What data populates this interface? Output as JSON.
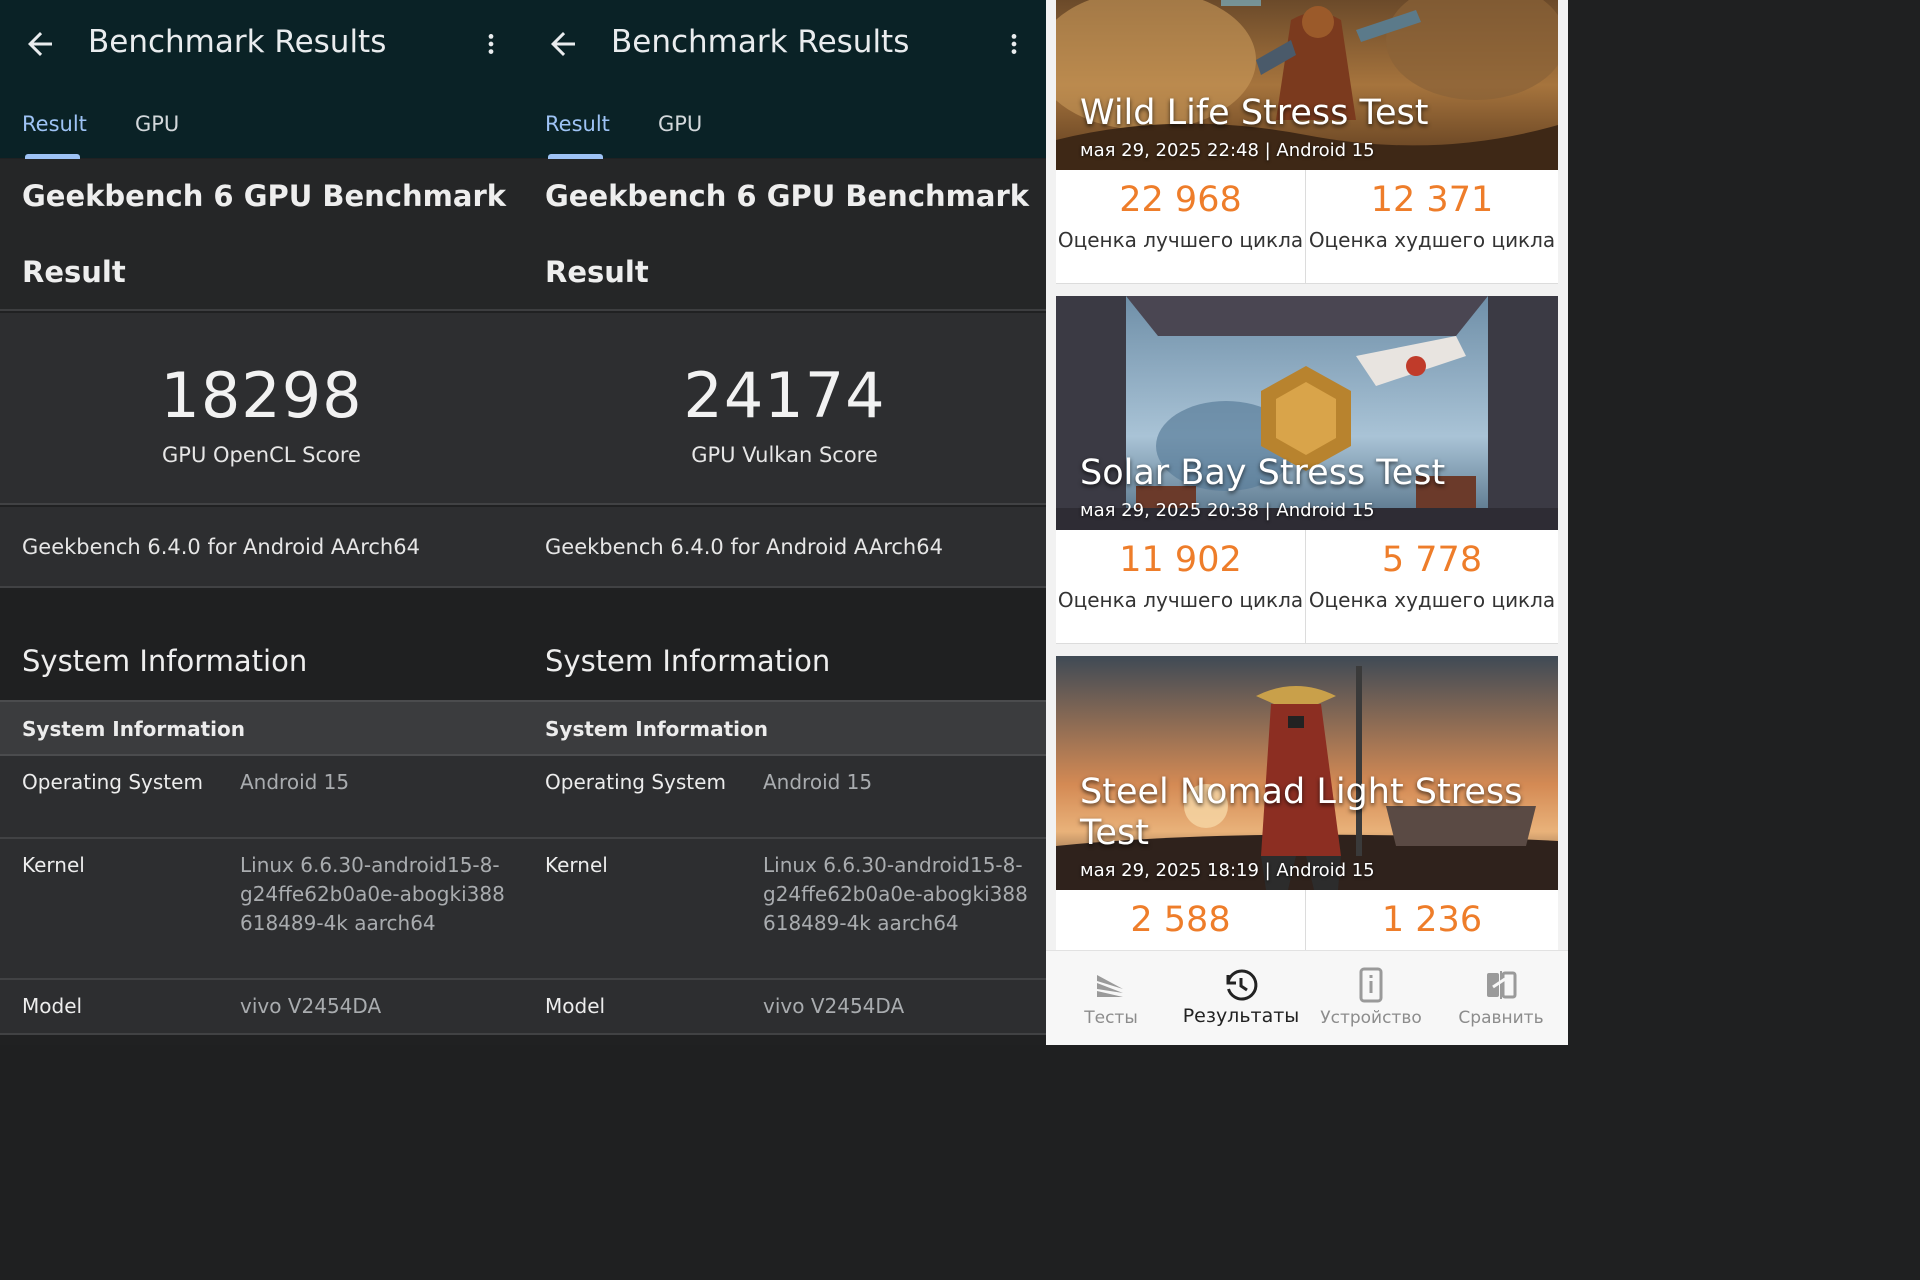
{
  "geekbench_panels": [
    {
      "title": "Benchmark Results",
      "tabs": [
        "Result",
        "GPU"
      ],
      "benchmark_title": "Geekbench 6 GPU Benchmark",
      "section_result": "Result",
      "score": "18298",
      "score_label": "GPU OpenCL Score",
      "version": "Geekbench 6.4.0 for Android AArch64",
      "system_info_title": "System Information",
      "system_info_bar": "System Information",
      "rows": [
        {
          "label": "Operating System",
          "value": "Android 15"
        },
        {
          "label": "Kernel",
          "value": "Linux 6.6.30-android15-8-g24ffe62b0a0e-abogki388618489-4k aarch64"
        },
        {
          "label": "Model",
          "value": "vivo V2454DA"
        }
      ]
    },
    {
      "title": "Benchmark Results",
      "tabs": [
        "Result",
        "GPU"
      ],
      "benchmark_title": "Geekbench 6 GPU Benchmark",
      "section_result": "Result",
      "score": "24174",
      "score_label": "GPU Vulkan Score",
      "version": "Geekbench 6.4.0 for Android AArch64",
      "system_info_title": "System Information",
      "system_info_bar": "System Information",
      "rows": [
        {
          "label": "Operating System",
          "value": "Android 15"
        },
        {
          "label": "Kernel",
          "value": "Linux 6.6.30-android15-8-g24ffe62b0a0e-abogki388618489-4k aarch64"
        },
        {
          "label": "Model",
          "value": "vivo V2454DA"
        }
      ]
    }
  ],
  "tdmark": {
    "results": [
      {
        "name": "Wild Life Stress Test",
        "meta": "мая 29, 2025 22:48 | Android 15",
        "best_score": "22 968",
        "best_label": "Оценка лучшего цикла",
        "worst_score": "12 371",
        "worst_label": "Оценка худшего цикла"
      },
      {
        "name": "Solar Bay Stress Test",
        "meta": "мая 29, 2025 20:38 | Android 15",
        "best_score": "11 902",
        "best_label": "Оценка лучшего цикла",
        "worst_score": "5 778",
        "worst_label": "Оценка худшего цикла"
      },
      {
        "name": "Steel Nomad Light Stress Test",
        "meta": "мая 29, 2025 18:19 | Android 15",
        "best_score": "2 588",
        "worst_score": "1 236"
      }
    ],
    "nav": [
      {
        "label": "Тесты",
        "icon": "tests-icon",
        "active": false
      },
      {
        "label": "Результаты",
        "icon": "history-icon",
        "active": true
      },
      {
        "label": "Устройство",
        "icon": "device-info-icon",
        "active": false
      },
      {
        "label": "Сравнить",
        "icon": "compare-icon",
        "active": false
      }
    ],
    "colors": {
      "score_orange": "#ee7d2a",
      "nav_active": "#222222",
      "nav_inactive": "#8c8c8c"
    }
  },
  "colors": {
    "geekbench_appbar": "#0a2226",
    "geekbench_tab_active": "#9ec3f5"
  }
}
